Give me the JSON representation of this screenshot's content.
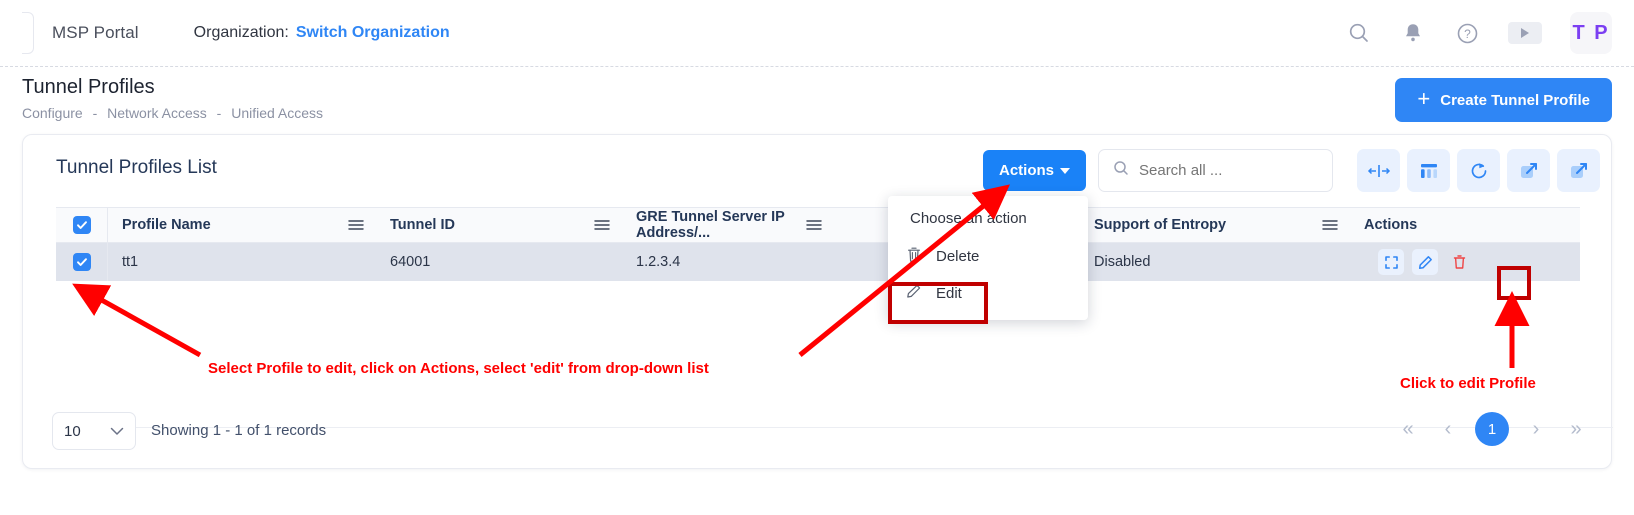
{
  "topbar": {
    "brand": "MSP Portal",
    "org_label": "Organization:",
    "org_link": "Switch Organization",
    "icons": [
      "search-icon",
      "bell-icon",
      "help-icon",
      "play-icon"
    ],
    "avatar_initials": "T P"
  },
  "page": {
    "title": "Tunnel Profiles",
    "breadcrumb": [
      "Configure",
      "Network Access",
      "Unified Access"
    ],
    "breadcrumb_separator": "-",
    "create_button": "Create Tunnel Profile",
    "create_button_icon": "plus-icon"
  },
  "card": {
    "title": "Tunnel Profiles List",
    "actions_button": "Actions",
    "search_placeholder": "Search all ...",
    "search_value": "",
    "tools": [
      "fit-columns-icon",
      "columns-icon",
      "refresh-icon",
      "expand-icon",
      "export-icon"
    ]
  },
  "table": {
    "columns": [
      "Profile Name",
      "Tunnel ID",
      "GRE Tunnel Server IP Address/...",
      "",
      "Support of Entropy",
      "Actions"
    ],
    "rows": [
      {
        "selected": true,
        "profile_name": "tt1",
        "tunnel_id": "64001",
        "gre_ip": "1.2.3.4",
        "hidden_col": "",
        "support_of_entropy": "Disabled",
        "actions": [
          "expand-icon",
          "edit-icon",
          "delete-icon"
        ]
      }
    ],
    "header_select_all": true
  },
  "dropdown": {
    "title": "Choose an action",
    "items": [
      {
        "label": "Delete",
        "icon": "trash-icon"
      },
      {
        "label": "Edit",
        "icon": "pencil-icon"
      }
    ]
  },
  "footer": {
    "page_size": "10",
    "showing": "Showing 1 - 1 of 1 records",
    "pager": {
      "first": "«",
      "prev": "‹",
      "current": "1",
      "next": "›",
      "last": "»"
    }
  },
  "annotations": [
    "Select Profile to edit, click on Actions, select 'edit' from drop-down list",
    "Click to edit Profile"
  ],
  "colors": {
    "accent_blue": "#2f86f5",
    "annotation_red": "#ff0000",
    "highlight_red": "#c00000",
    "avatar_purple": "#7b3ff2",
    "row_selected": "#dfe3ec"
  }
}
